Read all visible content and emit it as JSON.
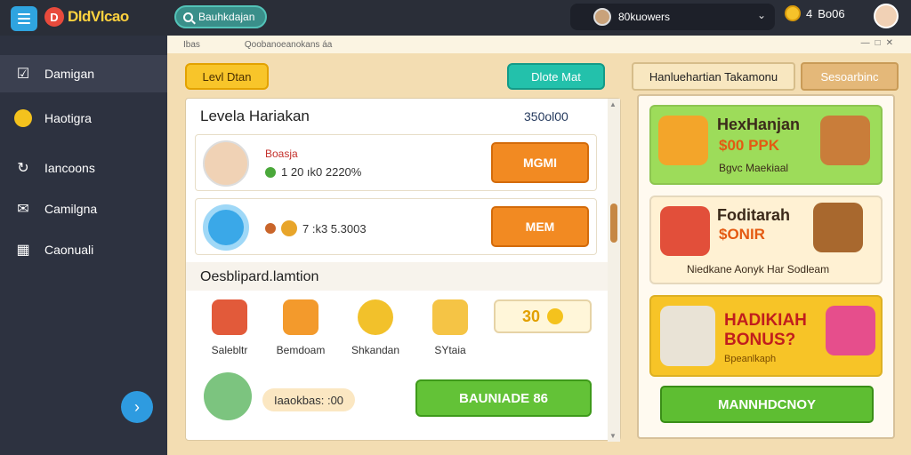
{
  "topbar": {
    "logo_text": "DldVlcao",
    "search_text": "Bauhkdajan",
    "user_name": "80kuowers",
    "coin_count": "4",
    "coin_label": "Bo06"
  },
  "sidebar": {
    "items": [
      {
        "label": "Damigan",
        "icon": "checkbox-icon"
      },
      {
        "label": "Haotigra",
        "icon": "coin-icon"
      },
      {
        "label": "Iancoons",
        "icon": "refresh-icon"
      },
      {
        "label": "Camilgna",
        "icon": "envelope-icon"
      },
      {
        "label": "Caonuali",
        "icon": "calendar-icon"
      }
    ]
  },
  "main": {
    "crumb_left": "Ibas",
    "crumb_right": "Qoobanoeanokans áa",
    "level_button": "Levl Dtan",
    "teal_button": "Dlote Mat",
    "panel_title": "Levela Hariakan",
    "panel_score": "350ol00",
    "rows": [
      {
        "name": "Boasja",
        "stats": "1  20 ık0 2220%",
        "action": "MGMI"
      },
      {
        "name": "",
        "stats": "7 :k3 5.3003",
        "action": "MEM"
      }
    ],
    "section_title": "Oesblipard.lamtion",
    "gifts": [
      {
        "label": "Salebltr"
      },
      {
        "label": "Bemdoam"
      },
      {
        "label": "Shkandan"
      },
      {
        "label": "SYtaia"
      }
    ],
    "gift_pill": "30",
    "bottom_pill": "Iaaokbas: :00",
    "green_button": "BAUNIADE 86"
  },
  "right": {
    "tab1": "Hanluehartian Takamonu",
    "tab2": "Sesoarbinc",
    "cards": [
      {
        "title": "HexHanjan",
        "big": "$00 PPK",
        "sub": "Bgvc Maekiaal"
      },
      {
        "title": "Foditarah",
        "big": "$ONIR",
        "sub": "Niedkane  Aonyk Har Sodleam"
      },
      {
        "title": "HADIKIAH",
        "big": "BONUS?",
        "sub": "Bpeanlkaph"
      }
    ],
    "button": "MANNHDCNOY"
  },
  "colors": {
    "accent_yellow": "#f8c52a",
    "accent_teal": "#23c1ab",
    "accent_orange": "#f28a22",
    "accent_green": "#63c237",
    "sidebar_bg": "#2d3240"
  }
}
